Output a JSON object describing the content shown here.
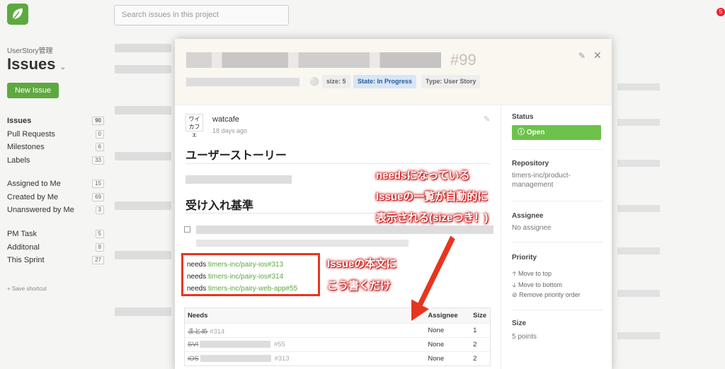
{
  "topbar": {
    "search_placeholder": "Search issues in this project",
    "notification_count": "5"
  },
  "sidebar": {
    "project_name": "UserStory管理",
    "page_title": "Issues",
    "new_issue_label": "New Issue",
    "groups": [
      [
        {
          "label": "Issues",
          "count": "90",
          "active": true
        },
        {
          "label": "Pull Requests",
          "count": "0"
        },
        {
          "label": "Milestones",
          "count": "6"
        },
        {
          "label": "Labels",
          "count": "33"
        }
      ],
      [
        {
          "label": "Assigned to Me",
          "count": "15"
        },
        {
          "label": "Created by Me",
          "count": "69"
        },
        {
          "label": "Unanswered by Me",
          "count": "3"
        }
      ],
      [
        {
          "label": "PM Task",
          "count": "5"
        },
        {
          "label": "Additonal",
          "count": "8"
        },
        {
          "label": "This Sprint",
          "count": "27"
        }
      ]
    ],
    "save_shortcut": "+ Save shortcut"
  },
  "modal": {
    "issue_number": "#99",
    "labels": {
      "size": "size: 5",
      "state": "State: In Progress",
      "type": "Type: User Story"
    },
    "author": "watcafe",
    "time_ago": "18 days ago",
    "avatar_text": "ワイ\nカフェ",
    "heading_story": "ユーザーストーリー",
    "heading_criteria": "受け入れ基準",
    "needs_lines": [
      {
        "prefix": "needs",
        "link": "timers-inc/pairy-ios#313"
      },
      {
        "prefix": "needs",
        "link": "timers-inc/pairy-ios#314"
      },
      {
        "prefix": "needs",
        "link": "timers-inc/pairy-web-app#55"
      }
    ],
    "needs_table": {
      "headers": {
        "needs": "Needs",
        "assignee": "Assignee",
        "size": "Size"
      },
      "rows": [
        {
          "name": "まとめ",
          "number": "#314",
          "assignee": "None",
          "size": "1"
        },
        {
          "name": "SVI",
          "number": "#55",
          "assignee": "None",
          "size": "2"
        },
        {
          "name": "iOS",
          "number": "#313",
          "assignee": "None",
          "size": "2"
        }
      ]
    },
    "side": {
      "status_label": "Status",
      "status_value": "Open",
      "repository_label": "Repository",
      "repository_value": "timers-inc/product-management",
      "assignee_label": "Assignee",
      "assignee_value": "No assignee",
      "priority_label": "Priority",
      "priority_actions": [
        "Move to top",
        "Move to bottom",
        "Remove priority order"
      ],
      "size_label": "Size",
      "size_value": "5 points"
    }
  },
  "annotations": {
    "top_lines": [
      "needsになっている",
      "Issueの一覧が自動的に",
      "表示される(sizeつき！)"
    ],
    "box_lines": [
      "Issueの本文に",
      "こう書くだけ"
    ]
  },
  "colors": {
    "brand_green": "#5da93f",
    "open_green": "#6cc24a",
    "annotation_red": "#e8351f",
    "state_badge_bg": "#d7e6f7"
  }
}
